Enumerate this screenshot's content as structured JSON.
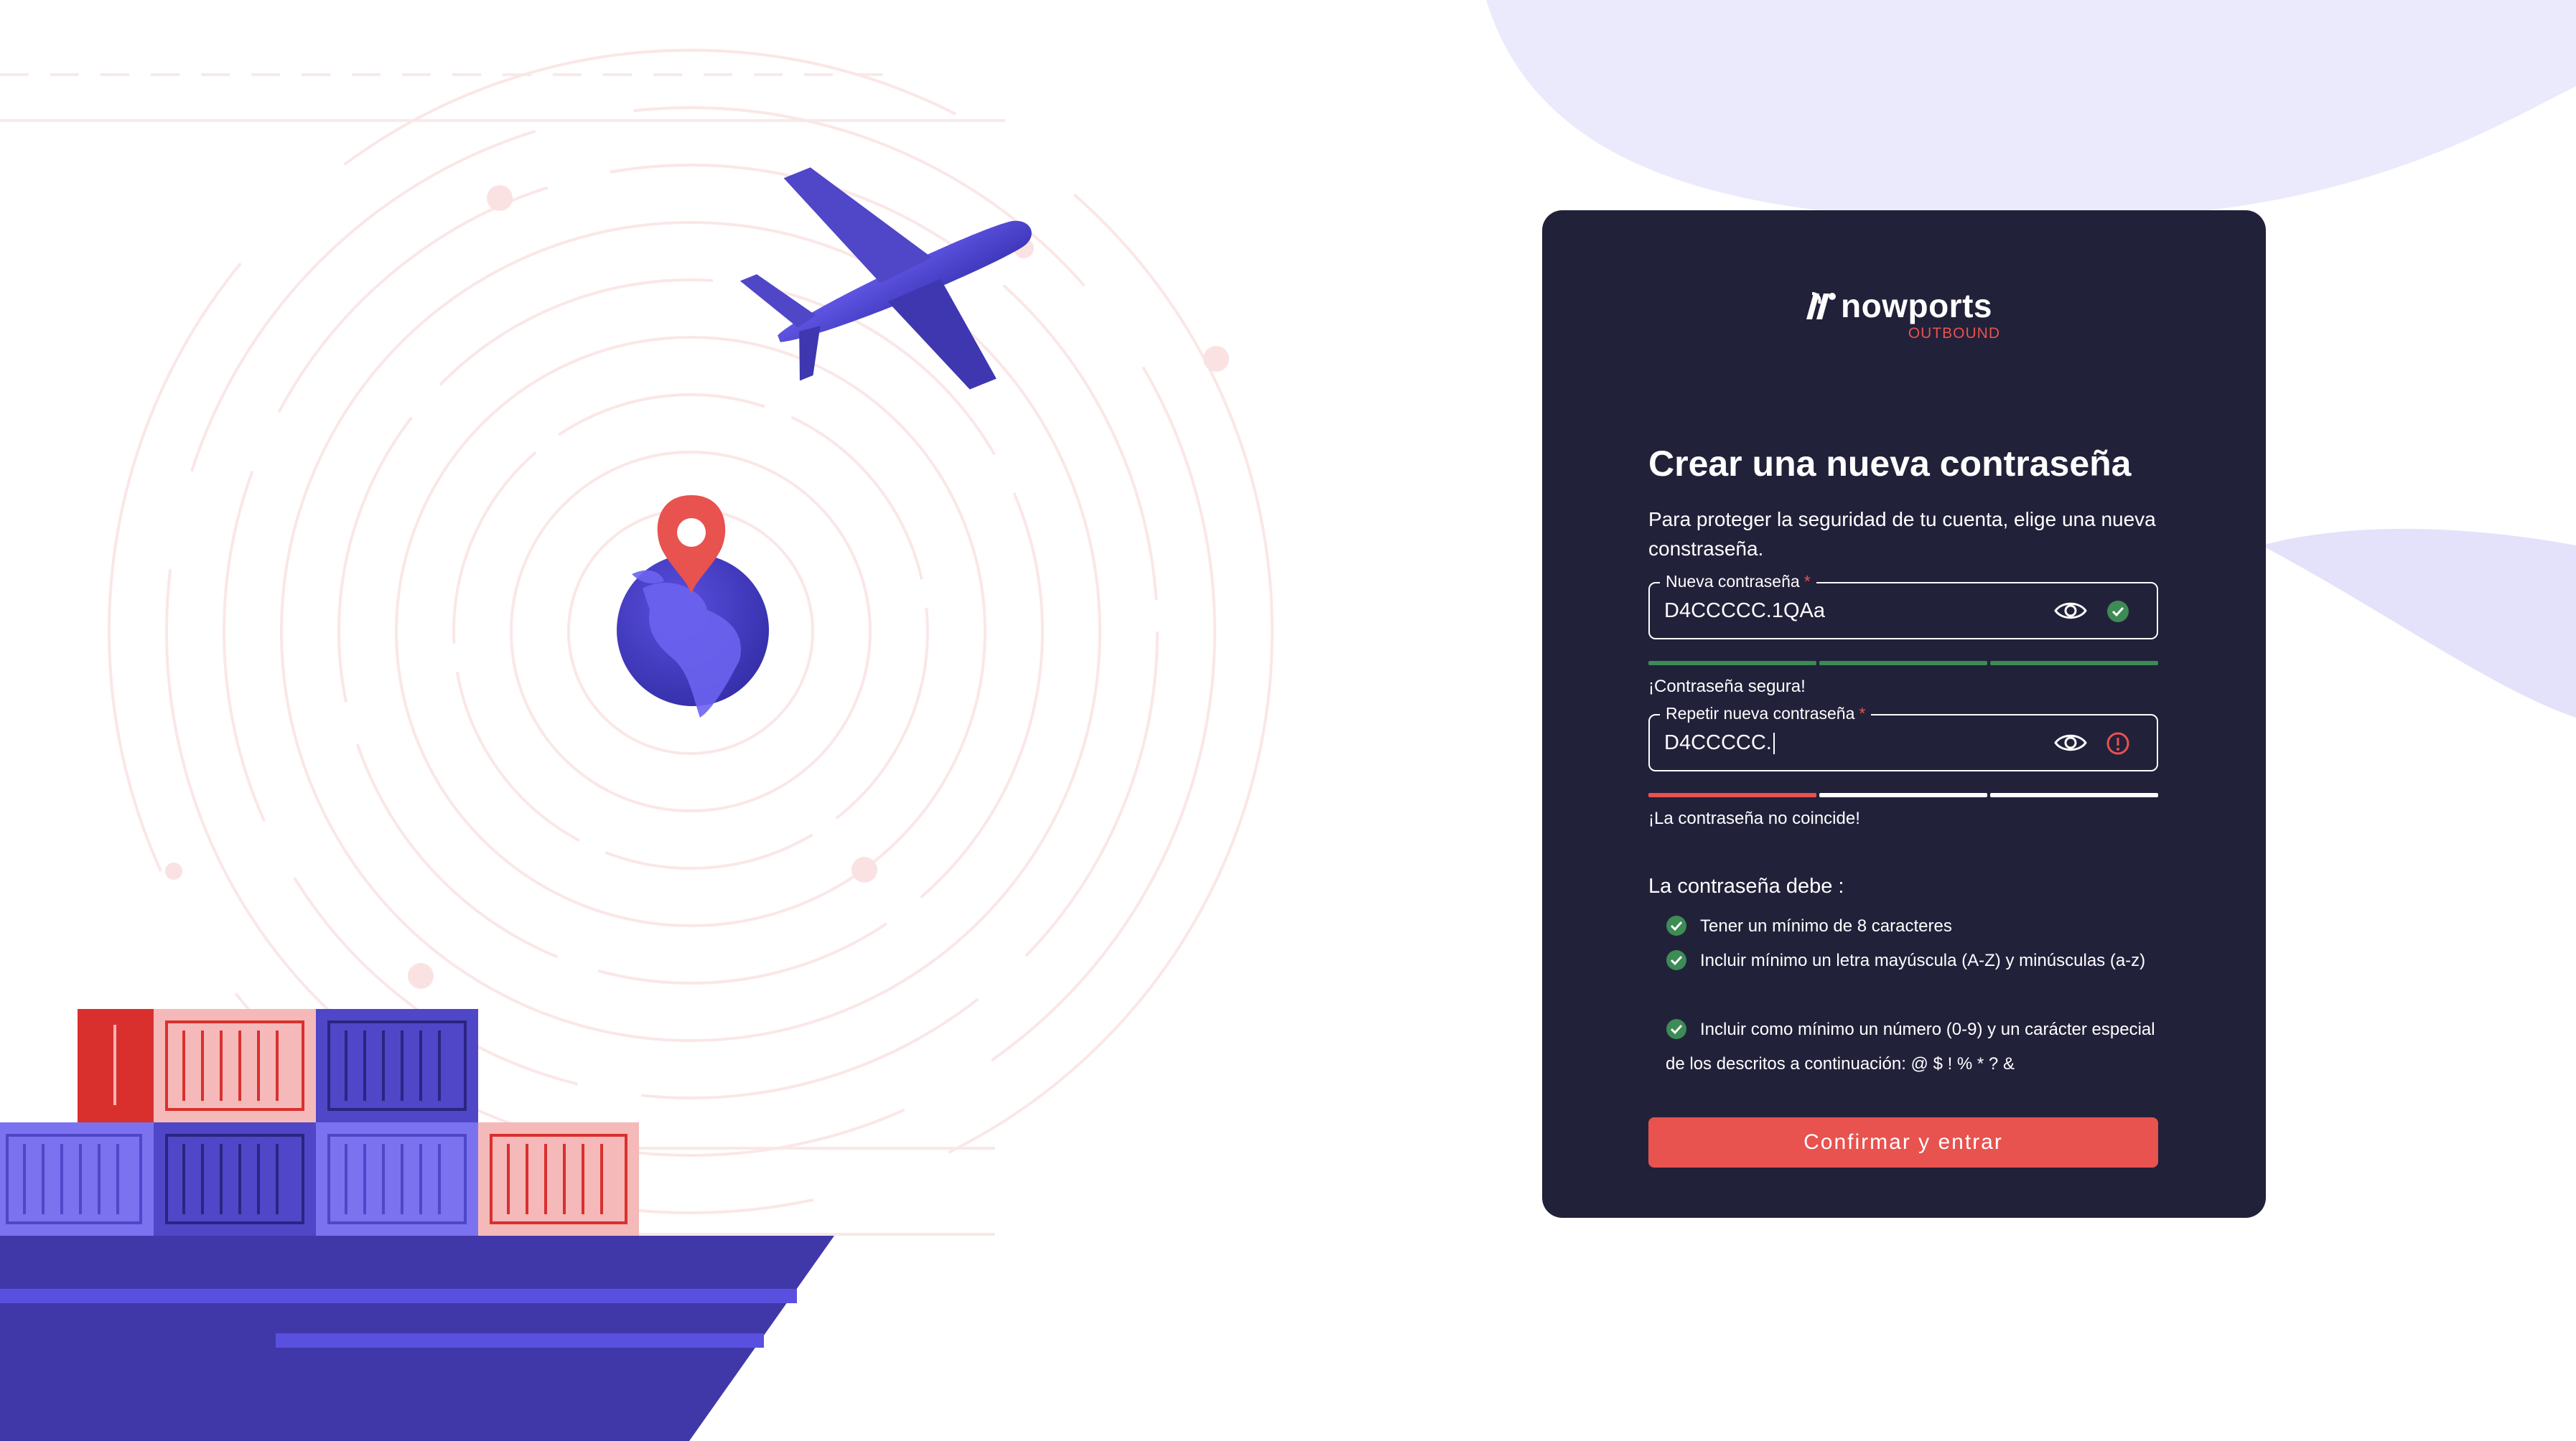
{
  "brand": {
    "name": "nowports",
    "tagline": "OUTBOUND"
  },
  "form": {
    "title": "Crear una nueva contraseña",
    "description": "Para proteger la seguridad de tu cuenta, elige una nueva constraseña.",
    "new_password": {
      "label": "Nueva contraseña",
      "required_mark": "*",
      "value": "D4CCCCC.1QAa",
      "status": "valid",
      "strength_segments_filled": 3,
      "hint": "¡Contraseña segura!"
    },
    "repeat_password": {
      "label": "Repetir nueva contraseña",
      "required_mark": "*",
      "value": "D4CCCCC.",
      "status": "error",
      "strength_segments_filled": 1,
      "hint": "¡La contraseña no coincide!"
    },
    "rules_title": "La contraseña debe :",
    "rules": [
      "Tener un mínimo de 8 caracteres",
      "Incluir mínimo un letra mayúscula (A-Z) y minúsculas (a-z)",
      "Incluir como mínimo un número (0-9) y un carácter especial de los descritos a continuación: @ $ ! % * ? &"
    ],
    "submit_label": "Confirmar y entrar"
  },
  "colors": {
    "card_bg": "#22213a",
    "accent_red": "#e8524f",
    "success_green": "#3d8b55",
    "brand_purple": "#4f46c8"
  },
  "icons": [
    "eye-icon",
    "check-circle-icon",
    "alert-circle-icon",
    "nowports-logo-icon"
  ]
}
